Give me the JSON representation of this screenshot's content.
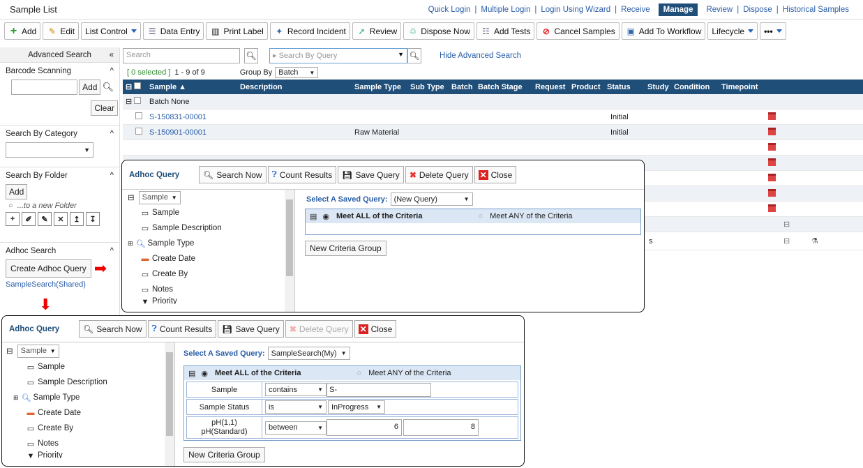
{
  "header": {
    "title": "Sample List",
    "nav": [
      "Quick Login",
      "Multiple Login",
      "Login Using Wizard",
      "Receive",
      "Manage",
      "Review",
      "Dispose",
      "Historical Samples"
    ],
    "active_nav": "Manage"
  },
  "toolbar": {
    "add": "Add",
    "edit": "Edit",
    "list_control": "List Control",
    "data_entry": "Data Entry",
    "print_label": "Print Label",
    "record_incident": "Record Incident",
    "review": "Review",
    "dispose_now": "Dispose Now",
    "add_tests": "Add Tests",
    "cancel_samples": "Cancel Samples",
    "add_to_workflow": "Add To Workflow",
    "lifecycle": "Lifecycle",
    "more": "•••"
  },
  "left": {
    "advanced_search": "Advanced Search",
    "barcode_scanning": "Barcode Scanning",
    "add": "Add",
    "clear": "Clear",
    "search_by_category": "Search By Category",
    "search_by_folder": "Search By Folder",
    "folder_add": "Add",
    "new_folder": "...to a new Folder",
    "adhoc_search": "Adhoc Search",
    "create_adhoc": "Create Adhoc Query",
    "saved_link": "SampleSearch(Shared)"
  },
  "grid": {
    "search_placeholder": "Search",
    "query_placeholder": "Search By Query",
    "hide_adv": "Hide Advanced Search",
    "selected": "[ 0 selected ]",
    "range": "1 - 9 of 9",
    "group_by_label": "Group By",
    "group_by_value": "Batch",
    "columns": [
      "Sample ▲",
      "Description",
      "Sample Type",
      "Sub Type",
      "Batch",
      "Batch Stage",
      "Request",
      "Product",
      "Status",
      "Study",
      "Condition",
      "Timepoint"
    ],
    "group_row": "Batch None",
    "rows": [
      {
        "sample": "S-150831-00001",
        "type": "",
        "status": "Initial"
      },
      {
        "sample": "S-150901-00001",
        "type": "Raw Material",
        "status": "Initial"
      }
    ],
    "partial_status": "s"
  },
  "popup1": {
    "title": "Adhoc Query",
    "search_now": "Search Now",
    "count_results": "Count Results",
    "save_query": "Save Query",
    "delete_query": "Delete Query",
    "close": "Close",
    "tree_root": "Sample",
    "tree": [
      "Sample",
      "Sample Description",
      "Sample Type",
      "Create Date",
      "Create By",
      "Notes",
      "Priority"
    ],
    "saved_query_label": "Select A Saved Query:",
    "saved_query_value": "(New Query)",
    "meet_all": "Meet ALL of the Criteria",
    "meet_any": "Meet ANY of the Criteria",
    "new_group": "New Criteria Group"
  },
  "popup2": {
    "title": "Adhoc Query",
    "search_now": "Search Now",
    "count_results": "Count Results",
    "save_query": "Save Query",
    "delete_query": "Delete Query",
    "close": "Close",
    "tree_root": "Sample",
    "tree": [
      "Sample",
      "Sample Description",
      "Sample Type",
      "Create Date",
      "Create By",
      "Notes",
      "Priority"
    ],
    "saved_query_label": "Select A Saved Query:",
    "saved_query_value": "SampleSearch(My)",
    "meet_all": "Meet ALL of the Criteria",
    "meet_any": "Meet ANY of the Criteria",
    "criteria": [
      {
        "field": "Sample",
        "op": "contains",
        "value": "S-"
      },
      {
        "field": "Sample Status",
        "op": "is",
        "value": "InProgress"
      },
      {
        "field": "pH(1,1)",
        "field2": "pH(Standard)",
        "op": "between",
        "value": "6",
        "value2": "8"
      }
    ],
    "new_group": "New Criteria Group"
  }
}
